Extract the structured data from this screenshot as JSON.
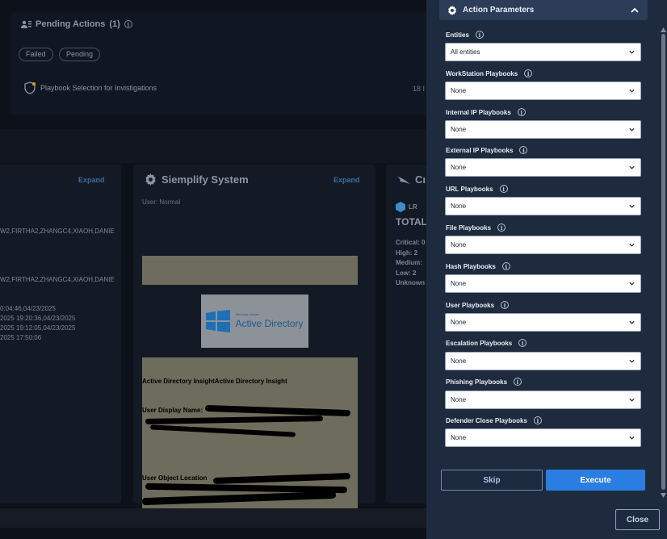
{
  "background": {
    "pending": {
      "title": "Pending Actions",
      "count": "(1)",
      "chips": [
        "Failed",
        "Pending"
      ],
      "item_label": "Playbook Selection for Invistigations",
      "item_right": "18 I"
    },
    "left_card": {
      "expand": "Expand",
      "lines": [
        "W2,FIRTHA2,ZHANGC4,XIAOH,DANIE",
        "W2,FIRTHA2,ZHANGC4,XIAOH,DANIE",
        "0:04:46,04/23/2025",
        "2025 19:20:36,04/23/2025",
        "2025 19:12:05,04/23/2025",
        "2025 17:50:06"
      ]
    },
    "mid_card": {
      "title": "Siemplify System",
      "expand": "Expand",
      "subtitle": "User: Normal",
      "ad_logo_small": "Windows Server",
      "ad_logo_text": "Active Directory",
      "insight_title": "Active Directory InsightActive Directory Insight",
      "display_name_label": "User Display Name:",
      "object_location_label": "User Object Location"
    },
    "right_card": {
      "title_fragment": "Cı",
      "lr_label": "LR",
      "total_label": "TOTAL",
      "lines": [
        "Critical: 0",
        "High: 2",
        "Medium:",
        "Low: 2",
        "Unknown"
      ]
    }
  },
  "panel": {
    "header_title": "Action Parameters",
    "fields": [
      {
        "label": "Entities",
        "value": "All entities"
      },
      {
        "label": "WorkStation Playbooks",
        "value": "None"
      },
      {
        "label": "Internal IP Playbooks",
        "value": "None"
      },
      {
        "label": "External IP Playbooks",
        "value": "None"
      },
      {
        "label": "URL Playbooks",
        "value": "None"
      },
      {
        "label": "File Playbooks",
        "value": "None"
      },
      {
        "label": "Hash Playbooks",
        "value": "None"
      },
      {
        "label": "User Playbooks",
        "value": "None"
      },
      {
        "label": "Escalation Playbooks",
        "value": "None"
      },
      {
        "label": "Phishing Playbooks",
        "value": "None"
      },
      {
        "label": "Defender Close Playbooks",
        "value": "None"
      }
    ],
    "skip_label": "Skip",
    "execute_label": "Execute",
    "close_label": "Close"
  },
  "colors": {
    "panel_bg": "#1e2b3e",
    "header_bg": "#2b3d58",
    "execute_bg": "#2a7de1"
  },
  "icons": [
    "gear-icon",
    "chevron-up-icon",
    "chevron-down-icon",
    "info-icon",
    "shield-icon",
    "user-list-icon"
  ]
}
